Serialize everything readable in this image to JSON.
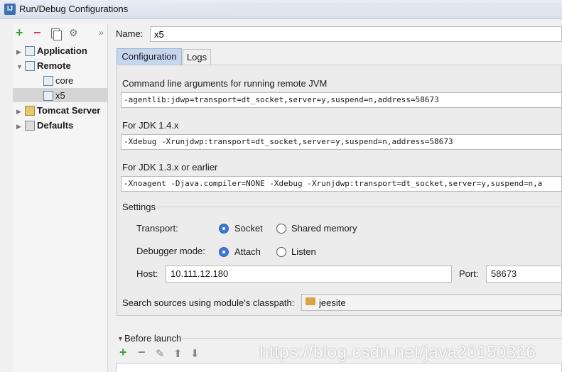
{
  "window": {
    "title": "Run/Debug Configurations",
    "app_icon": "IJ"
  },
  "toolbar": {
    "add": "+",
    "remove": "−",
    "more": "»"
  },
  "tree": {
    "items": [
      {
        "label": "Application",
        "icon": "application-icon",
        "bold": true,
        "expanded": false
      },
      {
        "label": "Remote",
        "icon": "remote-icon",
        "bold": true,
        "expanded": true
      },
      {
        "label": "core",
        "icon": "remote-config-icon",
        "bold": false
      },
      {
        "label": "x5",
        "icon": "remote-config-icon",
        "bold": false,
        "selected": true
      },
      {
        "label": "Tomcat Server",
        "icon": "tomcat-icon",
        "bold": true,
        "expanded": false
      },
      {
        "label": "Defaults",
        "icon": "wrench-icon",
        "bold": true,
        "expanded": false
      }
    ]
  },
  "name": {
    "label": "Name:",
    "value": "x5"
  },
  "tabs": [
    {
      "label": "Configuration",
      "active": true
    },
    {
      "label": "Logs",
      "active": false
    }
  ],
  "config": {
    "cmd_label": "Command line arguments for running remote JVM",
    "cmd_value": "-agentlib:jdwp=transport=dt_socket,server=y,suspend=n,address=58673",
    "jdk14_label": "For JDK 1.4.x",
    "jdk14_value": "-Xdebug -Xrunjdwp:transport=dt_socket,server=y,suspend=n,address=58673",
    "jdk13_label": "For JDK 1.3.x or earlier",
    "jdk13_value": "-Xnoagent -Djava.compiler=NONE -Xdebug -Xrunjdwp:transport=dt_socket,server=y,suspend=n,a",
    "settings_label": "Settings",
    "transport_label": "Transport:",
    "transport_options": [
      "Socket",
      "Shared memory"
    ],
    "transport_selected": "Socket",
    "debugger_label": "Debugger mode:",
    "debugger_options": [
      "Attach",
      "Listen"
    ],
    "debugger_selected": "Attach",
    "host_label": "Host:",
    "host_value": "10.111.12.180",
    "port_label": "Port:",
    "port_value": "58673",
    "module_label": "Search sources using module's classpath:",
    "module_value": "jeesite"
  },
  "before_launch": {
    "label": "Before launch"
  },
  "watermark": "https://blog.csdn.net/java20150326",
  "colors": {
    "tab_active": "#c5d6ee",
    "radio_on": "#3b78d8",
    "add_green": "#3aa03a",
    "remove_red": "#d23b3b"
  }
}
